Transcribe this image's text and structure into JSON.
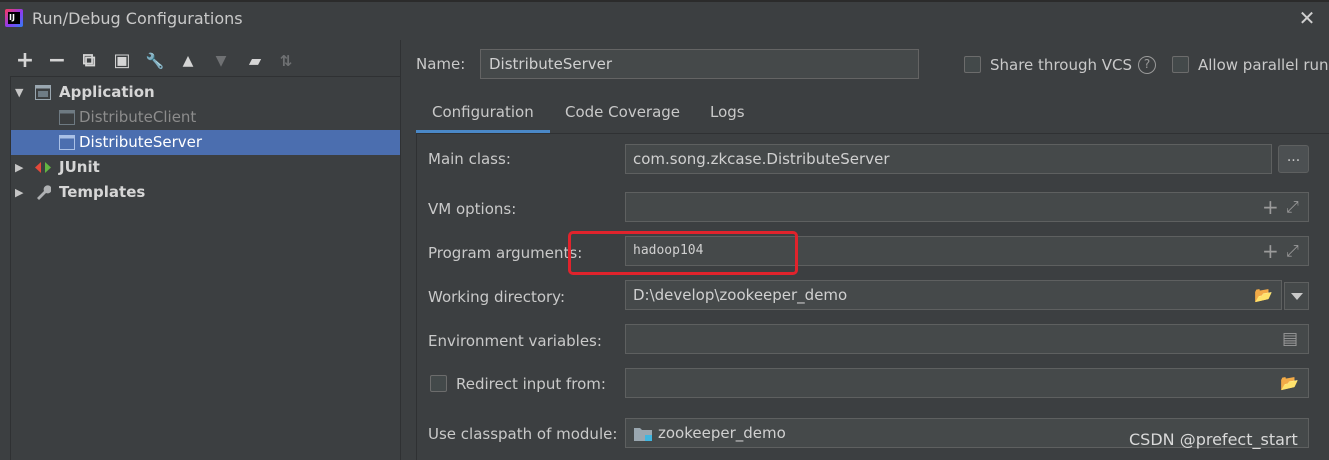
{
  "window": {
    "title": "Run/Debug Configurations",
    "logo_text": "IJ",
    "close_glyph": "✕"
  },
  "toolbar": {
    "icons": [
      "add-icon",
      "remove-icon",
      "copy-icon",
      "save-icon",
      "wrench-icon",
      "move-up-icon",
      "move-down-icon",
      "new-folder-icon",
      "sort-icon"
    ],
    "glyphs": {
      "add": "+",
      "remove": "−",
      "copy": "⧉",
      "save": "▣",
      "wrench": "🔧",
      "up": "▲",
      "down": "▼",
      "folder": "▰",
      "sort": "⇅"
    }
  },
  "tree": {
    "items": [
      {
        "label": "Application",
        "arrow": "▼"
      },
      {
        "label": "DistributeClient"
      },
      {
        "label": "DistributeServer"
      },
      {
        "label": "JUnit",
        "arrow": "▶"
      },
      {
        "label": "Templates",
        "arrow": "▶"
      }
    ]
  },
  "header": {
    "name_label": "Name:",
    "name_value": "DistributeServer",
    "share_vcs_label": "Share through VCS",
    "help_glyph": "?",
    "allow_parallel_label": "Allow parallel run"
  },
  "tabs": [
    {
      "label": "Configuration"
    },
    {
      "label": "Code Coverage"
    },
    {
      "label": "Logs"
    }
  ],
  "form": {
    "main_class": {
      "label": "Main class:",
      "value": "com.song.zkcase.DistributeServer",
      "browse": "..."
    },
    "vm_options": {
      "label": "VM options:",
      "value": ""
    },
    "program_arguments": {
      "label": "Program arguments:",
      "value": "hadoop104"
    },
    "working_directory": {
      "label": "Working directory:",
      "value": "D:\\develop\\zookeeper_demo"
    },
    "environment_variables": {
      "label": "Environment variables:",
      "value": ""
    },
    "redirect_input": {
      "label": "Redirect input from:",
      "value": ""
    },
    "classpath_module": {
      "label": "Use classpath of module:",
      "value": "zookeeper_demo"
    }
  },
  "field_glyphs": {
    "plus": "+",
    "expand": "⤢",
    "folder": "📂",
    "doc": "▤"
  },
  "watermark": "CSDN @prefect_start",
  "colors": {
    "background": "#3c3f41",
    "selection": "#4b6eaf",
    "tab_underline": "#4a88c7",
    "highlight_box": "#e0232c"
  }
}
